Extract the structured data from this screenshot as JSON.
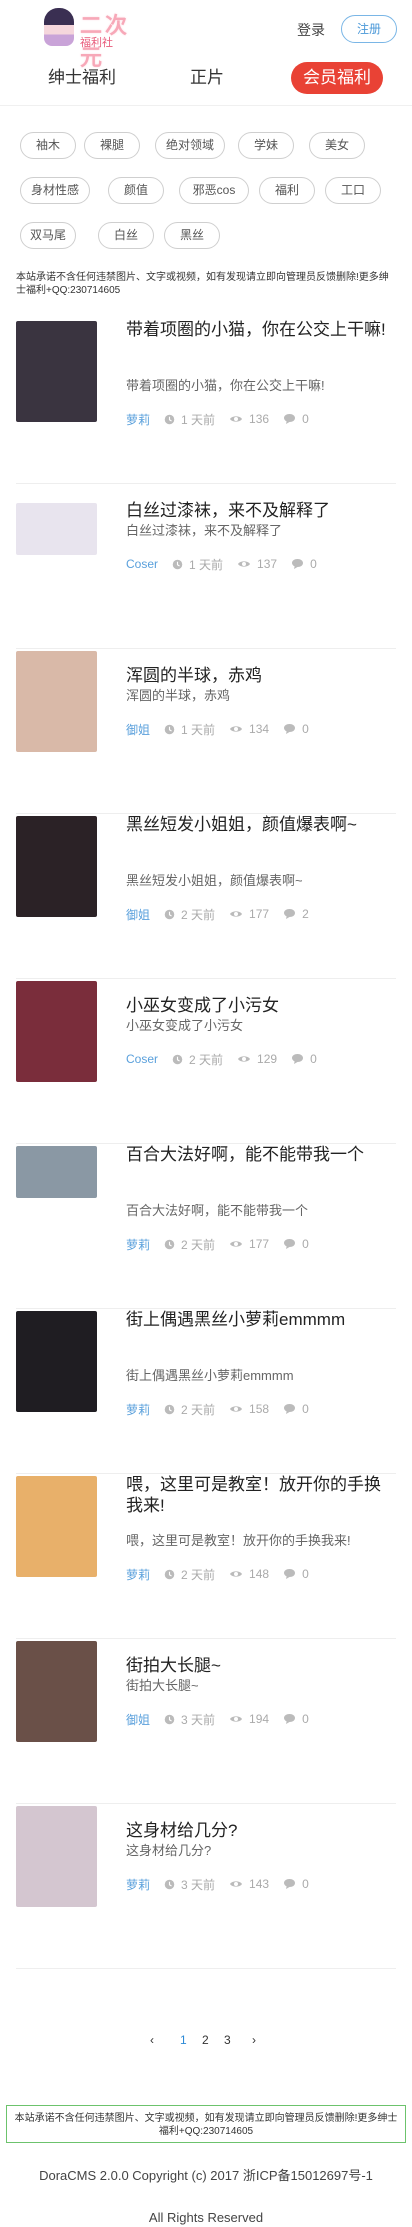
{
  "header": {
    "logo_title": "二次元",
    "logo_sub": "福利社",
    "login": "登录",
    "register": "注册"
  },
  "nav": [
    {
      "label": "绅士福利"
    },
    {
      "label": "正片"
    },
    {
      "label": "会员福利",
      "active": true
    }
  ],
  "tags": [
    "袖木",
    "裸腿",
    "绝对领域",
    "学妹",
    "美女",
    "身材性感",
    "颜值",
    "邪恶cos",
    "福利",
    "工口",
    "双马尾",
    "白丝",
    "黑丝"
  ],
  "notice": "本站承诺不含任何违禁图片、文字或视频，如有发现请立即向管理员反馈删除!更多绅士福利+QQ:230714605",
  "articles": [
    {
      "title": "带着项圈的小猫，你在公交上干嘛!",
      "excerpt": "带着项圈的小猫，你在公交上干嘛!",
      "category": "萝莉",
      "time": "1 天前",
      "views": "136",
      "comments": "0",
      "thumb_color": "#3a3440"
    },
    {
      "title": "白丝过漆袜，来不及解释了",
      "excerpt": "白丝过漆袜，来不及解释了",
      "category": "Coser",
      "time": "1 天前",
      "views": "137",
      "comments": "0",
      "thumb_color": "#e8e4ee"
    },
    {
      "title": "浑圆的半球，赤鸡",
      "excerpt": "浑圆的半球，赤鸡",
      "category": "御姐",
      "time": "1 天前",
      "views": "134",
      "comments": "0",
      "thumb_color": "#d9b9a8"
    },
    {
      "title": "黑丝短发小姐姐，颜值爆表啊~",
      "excerpt": "黑丝短发小姐姐，颜值爆表啊~",
      "category": "御姐",
      "time": "2 天前",
      "views": "177",
      "comments": "2",
      "thumb_color": "#2b2226"
    },
    {
      "title": "小巫女变成了小污女",
      "excerpt": "小巫女变成了小污女",
      "category": "Coser",
      "time": "2 天前",
      "views": "129",
      "comments": "0",
      "thumb_color": "#7a2d3b"
    },
    {
      "title": "百合大法好啊，能不能带我一个",
      "excerpt": "百合大法好啊，能不能带我一个",
      "category": "萝莉",
      "time": "2 天前",
      "views": "177",
      "comments": "0",
      "thumb_color": "#8a98a4"
    },
    {
      "title": "街上偶遇黑丝小萝莉emmmm",
      "excerpt": "街上偶遇黑丝小萝莉emmmm",
      "category": "萝莉",
      "time": "2 天前",
      "views": "158",
      "comments": "0",
      "thumb_color": "#1f1d22"
    },
    {
      "title": "喂，这里可是教室！放开你的手换我来!",
      "excerpt": "喂，这里可是教室！放开你的手换我来!",
      "category": "萝莉",
      "time": "2 天前",
      "views": "148",
      "comments": "0",
      "thumb_color": "#e8b06a"
    },
    {
      "title": "街拍大长腿~",
      "excerpt": "街拍大长腿~",
      "category": "御姐",
      "time": "3 天前",
      "views": "194",
      "comments": "0",
      "thumb_color": "#6a5048"
    },
    {
      "title": "这身材给几分?",
      "excerpt": "这身材给几分?",
      "category": "萝莉",
      "time": "3 天前",
      "views": "143",
      "comments": "0",
      "thumb_color": "#d4c6d0"
    }
  ],
  "pagination": {
    "prev": "‹",
    "pages": [
      "1",
      "2",
      "3"
    ],
    "current": "1",
    "next": "›"
  },
  "footer": {
    "notice": "本站承诺不含任何违禁图片、文字或视频，如有发现请立即向管理员反馈删除!更多绅士福利+QQ:230714605",
    "copyright": "DoraCMS 2.0.0  Copyright (c) 2017   浙ICP备15012697号-1",
    "rights": "All Rights Reserved"
  },
  "colors": {
    "accent": "#e94235",
    "link": "#5aa0dc",
    "notice_border": "#6cc36c"
  }
}
